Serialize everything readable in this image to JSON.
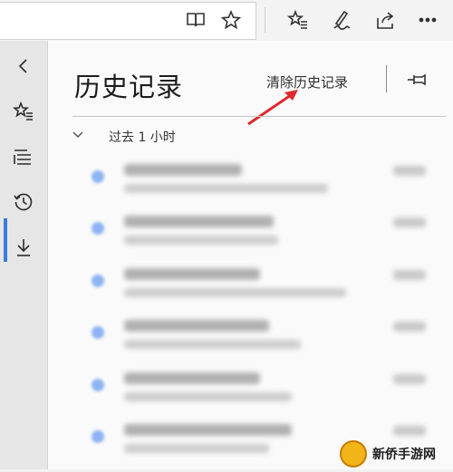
{
  "panel": {
    "title": "历史记录",
    "clear_history_label": "清除历史记录"
  },
  "history": {
    "group_label": "过去 1 小时",
    "items_blurred": 6
  },
  "watermark": {
    "text": "新侨手游网"
  },
  "colors": {
    "accent": "#3b7be0",
    "annotation_arrow": "#e0282e",
    "favicon": "#8cb4f2"
  },
  "icons": {
    "toolbar": [
      "reading-view-icon",
      "favorite-star-icon",
      "favorites-hub-icon",
      "pen-notes-icon",
      "share-icon"
    ],
    "rail": [
      "back-chevron-icon",
      "favorites-icon",
      "reading-list-icon",
      "history-icon",
      "downloads-icon"
    ]
  }
}
